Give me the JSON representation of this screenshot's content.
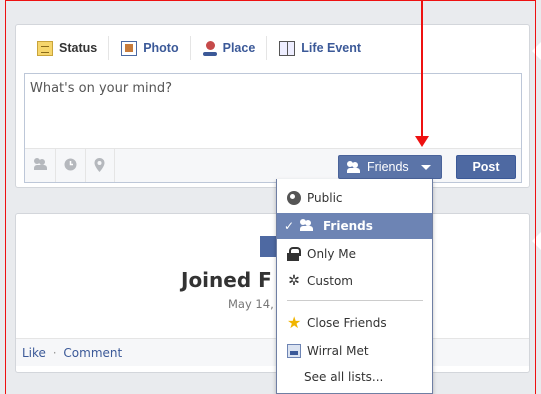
{
  "composer": {
    "tabs": [
      {
        "label": "Status",
        "icon": "status-icon"
      },
      {
        "label": "Photo",
        "icon": "photo-icon"
      },
      {
        "label": "Place",
        "icon": "place-icon"
      },
      {
        "label": "Life Event",
        "icon": "life-event-icon"
      }
    ],
    "placeholder": "What's on your mind?",
    "bar_icons": [
      "tag-people-icon",
      "clock-icon",
      "location-pin-icon"
    ],
    "audience_label": "Friends",
    "post_label": "Post"
  },
  "story": {
    "title": "Joined F",
    "date": "May 14,",
    "actions": {
      "like": "Like",
      "separator": "·",
      "comment": "Comment"
    }
  },
  "dropdown": {
    "items": [
      {
        "label": "Public",
        "icon": "globe-icon",
        "selected": false
      },
      {
        "label": "Friends",
        "icon": "friends-icon",
        "selected": true
      },
      {
        "label": "Only Me",
        "icon": "lock-icon",
        "selected": false
      },
      {
        "label": "Custom",
        "icon": "gear-icon",
        "selected": false
      }
    ],
    "lists": [
      {
        "label": "Close Friends",
        "icon": "star-icon"
      },
      {
        "label": "Wirral Met",
        "icon": "group-list-icon"
      },
      {
        "label": "See all lists...",
        "icon": ""
      }
    ]
  },
  "colors": {
    "brand_blue": "#3b5998",
    "button_blue": "#5b74a8",
    "selected_blue": "#6d84b4",
    "annotation_red": "#ee1111"
  }
}
